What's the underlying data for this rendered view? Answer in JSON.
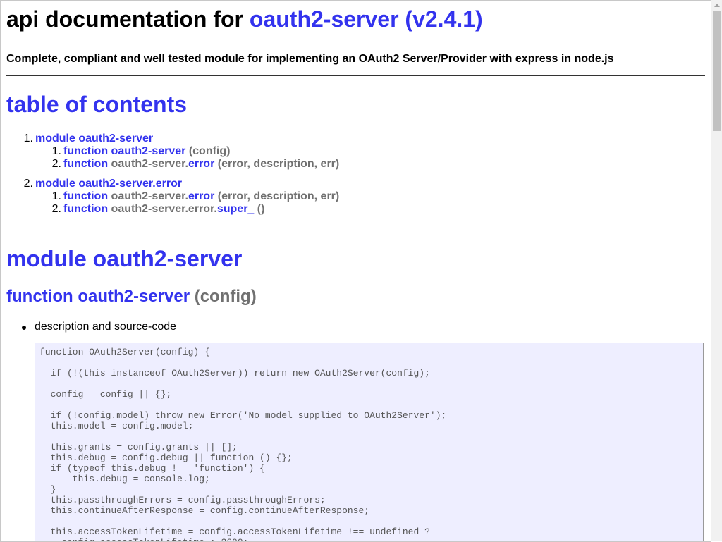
{
  "header": {
    "title_prefix": "api documentation for",
    "title_link": "oauth2-server (v2.4.1)",
    "description": "Complete, compliant and well tested module for implementing an OAuth2 Server/Provider with express in node.js"
  },
  "toc": {
    "heading": "table of contents",
    "items": [
      {
        "num": "1.",
        "label": "module oauth2-server",
        "children": [
          {
            "num": "1.",
            "kw": "function",
            "parts": [
              {
                "text": "oauth2-server",
                "style": "blue"
              },
              {
                "text": " (config)",
                "style": "gray"
              }
            ]
          },
          {
            "num": "2.",
            "kw": "function",
            "parts": [
              {
                "text": "oauth2-server.",
                "style": "gray"
              },
              {
                "text": "error",
                "style": "blue"
              },
              {
                "text": " (error, description, err)",
                "style": "gray"
              }
            ]
          }
        ]
      },
      {
        "num": "2.",
        "label": "module oauth2-server.error",
        "children": [
          {
            "num": "1.",
            "kw": "function",
            "parts": [
              {
                "text": "oauth2-server.",
                "style": "gray"
              },
              {
                "text": "error",
                "style": "blue"
              },
              {
                "text": " (error, description, err)",
                "style": "gray"
              }
            ]
          },
          {
            "num": "2.",
            "kw": "function",
            "parts": [
              {
                "text": "oauth2-server.error.",
                "style": "gray"
              },
              {
                "text": "super_",
                "style": "blue"
              },
              {
                "text": " ()",
                "style": "gray"
              }
            ]
          }
        ]
      }
    ]
  },
  "module": {
    "heading": "module oauth2-server",
    "function_kw": "function",
    "function_name": "oauth2-server",
    "function_args": "(config)",
    "bullet": "description and source-code",
    "code": "function OAuth2Server(config) {\n\n  if (!(this instanceof OAuth2Server)) return new OAuth2Server(config);\n\n  config = config || {};\n\n  if (!config.model) throw new Error('No model supplied to OAuth2Server');\n  this.model = config.model;\n\n  this.grants = config.grants || [];\n  this.debug = config.debug || function () {};\n  if (typeof this.debug !== 'function') {\n      this.debug = console.log;\n  }\n  this.passthroughErrors = config.passthroughErrors;\n  this.continueAfterResponse = config.continueAfterResponse;\n\n  this.accessTokenLifetime = config.accessTokenLifetime !== undefined ?\n    config.accessTokenLifetime : 3600;"
  },
  "colors": {
    "link": "#3333ee",
    "muted": "#707070",
    "code_bg": "#eeeeff"
  }
}
